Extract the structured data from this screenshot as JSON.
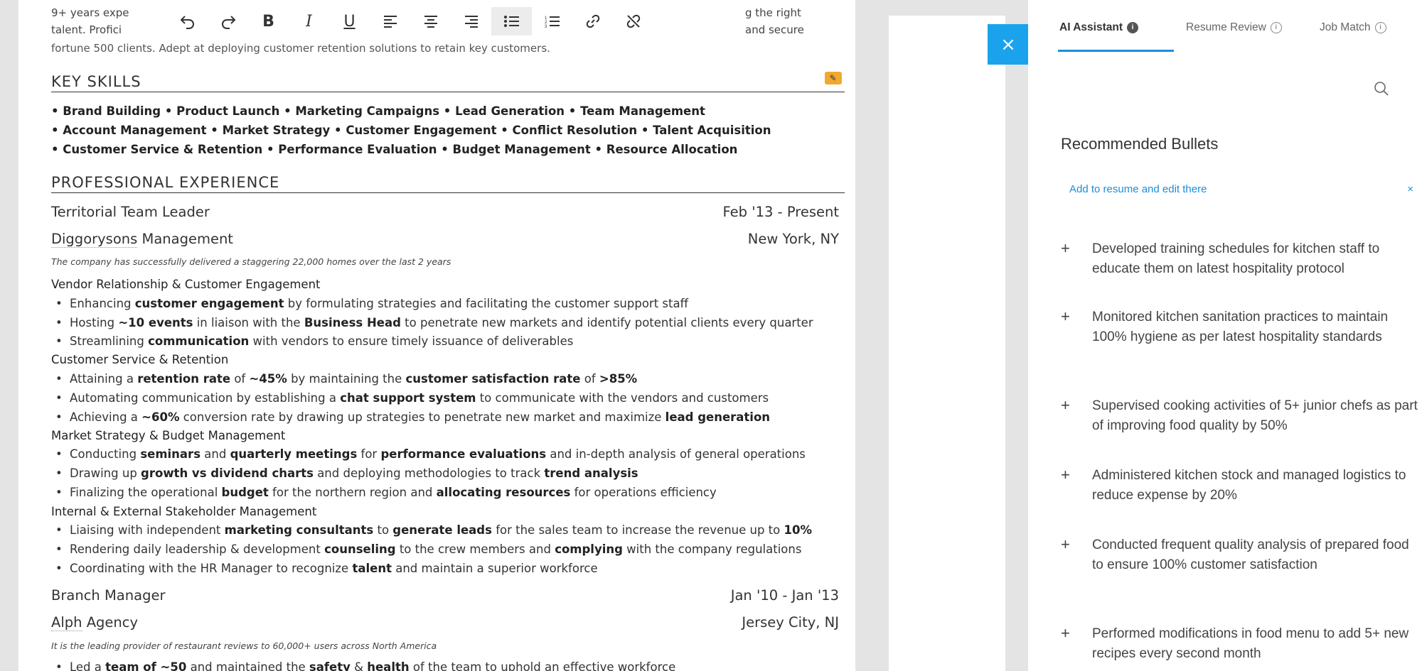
{
  "intro": {
    "line1_left": "9+ years expe",
    "line1_right": "g the right",
    "line2_left": "talent. Profici",
    "line2_right": "and secure",
    "line3": "fortune 500 clients. Adept at deploying customer retention solutions to retain key customers."
  },
  "toolbar": {
    "buttons": [
      "undo",
      "redo",
      "bold",
      "italic",
      "underline",
      "align-left",
      "align-center",
      "align-right",
      "bulleted-list",
      "numbered-list",
      "link",
      "unlink"
    ]
  },
  "skills": {
    "title": "KEY SKILLS",
    "lines": [
      "• Brand Building • Product Launch • Marketing Campaigns • Lead Generation • Team Management",
      "• Account Management • Market Strategy • Customer Engagement • Conflict Resolution • Talent Acquisition",
      "• Customer Service & Retention • Performance Evaluation • Budget Management • Resource Allocation"
    ]
  },
  "experience": {
    "title": "PROFESSIONAL EXPERIENCE",
    "job1": {
      "title": "Territorial Team Leader",
      "dates": "Feb '13  -  Present",
      "company": "Diggorysons",
      "company_rest": " Management",
      "location": "New York, NY",
      "desc": "The company has successfully delivered a staggering 22,000 homes over the last 2 years",
      "sub1": "Vendor Relationship & Customer Engagement",
      "sub2": "Customer Service & Retention",
      "sub3": "Market Strategy & Budget Management",
      "sub4": "Internal & External Stakeholder Management"
    },
    "job2": {
      "title": "Branch Manager",
      "dates": "Jan '10  -  Jan '13",
      "company": "Alph",
      "company_rest": " Agency",
      "location": "Jersey City, NJ",
      "desc": "It is the leading provider of restaurant reviews to 60,000+ users across North America"
    }
  },
  "panel": {
    "tabs": [
      "AI Assistant",
      "Resume Review",
      "Job Match"
    ],
    "close_label": "×",
    "recommended_title": "Recommended Bullets",
    "tip": "Add to resume and edit there",
    "tip_close": "×",
    "bullets": [
      "Developed training schedules for kitchen staff to educate them on latest hospitality protocol",
      "Monitored kitchen sanitation practices to maintain 100% hygiene as per latest hospitality standards",
      "Supervised cooking activities of 5+ junior chefs as part of improving food quality by 50%",
      "Administered kitchen stock and managed logistics to reduce expense by 20%",
      "Conducted frequent quality analysis of prepared food to ensure 100% customer satisfaction",
      "Performed modifications in food menu to add 5+ new recipes every second month"
    ]
  }
}
